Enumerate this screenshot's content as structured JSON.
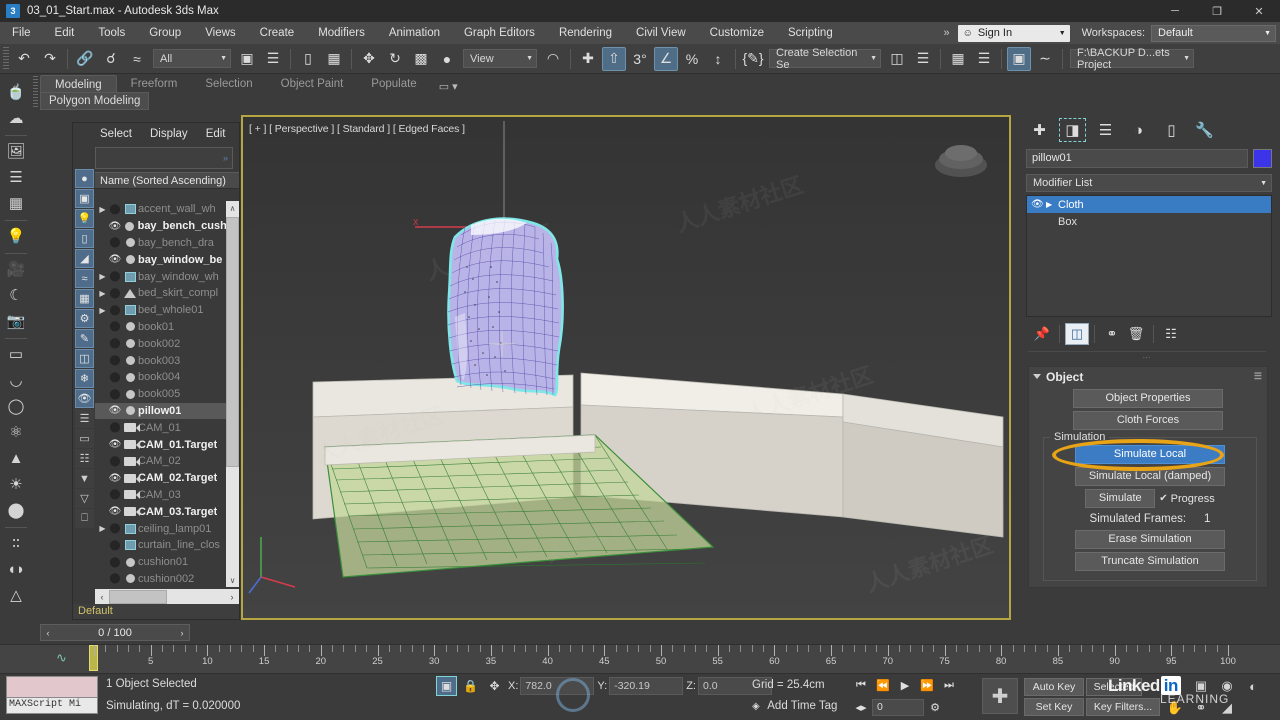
{
  "window": {
    "title": "03_01_Start.max - Autodesk 3ds Max",
    "app_badge": "3",
    "minimize": "─",
    "maximize": "❐",
    "close": "✕"
  },
  "menubar": {
    "items": [
      "File",
      "Edit",
      "Tools",
      "Group",
      "Views",
      "Create",
      "Modifiers",
      "Animation",
      "Graph Editors",
      "Rendering",
      "Civil View",
      "Customize",
      "Scripting"
    ],
    "overflow": "»",
    "sign_in": "Sign In",
    "workspaces_label": "Workspaces:",
    "workspace_value": "Default"
  },
  "toolbar": {
    "selection_filter": "All",
    "ref_coord_system": "View",
    "named_selection_sets": "Create Selection Se",
    "project_folder": "F:\\BACKUP D...ets Project",
    "icons": [
      "undo",
      "redo",
      "select-link",
      "unlink",
      "bind-space-warp",
      "select-object",
      "select-by-name",
      "rectangular-selection-region",
      "window-crossing",
      "select-and-move",
      "select-and-rotate",
      "select-and-scale",
      "placement",
      "mirror",
      "align",
      "percent-snap",
      "angle-snap",
      "spinner-snap",
      "edit-named-selection",
      "manage-layers",
      "toggle-scene-explorer",
      "curve-editor",
      "schematic-view",
      "material-editor",
      "render-setup",
      "rendered-frame-window",
      "render-production",
      "snaps-toggle"
    ]
  },
  "ribbon": {
    "tabs": [
      "Modeling",
      "Freeform",
      "Selection",
      "Object Paint",
      "Populate"
    ],
    "active_tab": "Modeling",
    "subtab": "Polygon Modeling",
    "overflow_caret": "▾"
  },
  "left_toolbar": {
    "icons": [
      "teapot-icon",
      "cloud-icon",
      "render-preview-icon",
      "list-panel-icon",
      "grid-panel-icon",
      "light-bulb-icon",
      "camera-rig-icon",
      "moon-shade-icon",
      "red-camera-icon",
      "plane-primitive-icon",
      "dome-primitive-icon",
      "sphere-primitive-icon",
      "teapot-wire-icon",
      "cone-primitive-icon",
      "sun-light-icon",
      "sphere-light-icon",
      "particles-icon",
      "dynamics-icon",
      "export-icon"
    ]
  },
  "explorer": {
    "menu": [
      "Select",
      "Display",
      "Edit"
    ],
    "search_placeholder": "",
    "search_clear": "»",
    "column_header": "Name (Sorted Ascending)",
    "side_icons": [
      "display-none-icon",
      "display-geometry-icon",
      "display-lights-icon",
      "display-cameras-icon",
      "display-helpers-icon",
      "display-space-warps-icon",
      "display-groups-icon",
      "display-xrefs-icon",
      "display-bones-icon",
      "display-containers-icon",
      "display-frozen-icon",
      "display-hidden-icon",
      "list-view-icon",
      "tile-view-icon",
      "detail-view-icon",
      "filter-funnel-icon",
      "filter-icon",
      "folder-icon"
    ],
    "items": [
      {
        "name": "accent_wall_wh",
        "expand": true,
        "visible": false,
        "type": "xref",
        "dim": true
      },
      {
        "name": "bay_bench_cush",
        "expand": false,
        "visible": true,
        "type": "geom",
        "dim": false
      },
      {
        "name": "bay_bench_dra",
        "expand": false,
        "visible": false,
        "type": "geom",
        "dim": true
      },
      {
        "name": "bay_window_be",
        "expand": false,
        "visible": true,
        "type": "geom",
        "dim": false
      },
      {
        "name": "bay_window_wh",
        "expand": true,
        "visible": false,
        "type": "xref",
        "dim": true
      },
      {
        "name": "bed_skirt_compl",
        "expand": true,
        "visible": false,
        "type": "helper",
        "dim": true
      },
      {
        "name": "bed_whole01",
        "expand": true,
        "visible": false,
        "type": "xref",
        "dim": true
      },
      {
        "name": "book01",
        "expand": false,
        "visible": false,
        "type": "geom",
        "dim": true
      },
      {
        "name": "book002",
        "expand": false,
        "visible": false,
        "type": "geom",
        "dim": true
      },
      {
        "name": "book003",
        "expand": false,
        "visible": false,
        "type": "geom",
        "dim": true
      },
      {
        "name": "book004",
        "expand": false,
        "visible": false,
        "type": "geom",
        "dim": true
      },
      {
        "name": "book005",
        "expand": false,
        "visible": false,
        "type": "geom",
        "dim": true
      },
      {
        "name": "pillow01",
        "expand": false,
        "visible": true,
        "type": "geom",
        "dim": false,
        "selected": true
      },
      {
        "name": "CAM_01",
        "expand": false,
        "visible": false,
        "type": "cam",
        "dim": true
      },
      {
        "name": "CAM_01.Target",
        "expand": false,
        "visible": true,
        "type": "cam",
        "dim": false
      },
      {
        "name": "CAM_02",
        "expand": false,
        "visible": false,
        "type": "cam",
        "dim": true
      },
      {
        "name": "CAM_02.Target",
        "expand": false,
        "visible": true,
        "type": "cam",
        "dim": false
      },
      {
        "name": "CAM_03",
        "expand": false,
        "visible": false,
        "type": "cam",
        "dim": true
      },
      {
        "name": "CAM_03.Target",
        "expand": false,
        "visible": true,
        "type": "cam",
        "dim": false
      },
      {
        "name": "ceiling_lamp01",
        "expand": true,
        "visible": false,
        "type": "xref",
        "dim": true
      },
      {
        "name": "curtain_line_clos",
        "expand": false,
        "visible": false,
        "type": "xref",
        "dim": true
      },
      {
        "name": "cushion01",
        "expand": false,
        "visible": false,
        "type": "geom",
        "dim": true
      },
      {
        "name": "cushion002",
        "expand": false,
        "visible": false,
        "type": "geom",
        "dim": true
      }
    ],
    "status": "Default",
    "scroll_up": "∧",
    "scroll_down": "∨",
    "hscroll_left": "‹",
    "hscroll_right": "›"
  },
  "viewport": {
    "label": "[ + ] [ Perspective ] [ Standard ] [ Edged Faces ]",
    "watermarks": [
      "人人素材社区",
      "人人素材社区",
      "人人素材社区",
      "人人素材社区",
      "人人素材社区",
      "人人素材社区"
    ],
    "axis_label_x": "X"
  },
  "command_panel": {
    "tabs": [
      "create-tab",
      "modify-tab",
      "hierarchy-tab",
      "motion-tab",
      "display-tab",
      "utilities-tab"
    ],
    "active_tab_index": 1,
    "object_name": "pillow01",
    "object_color": "#3b34e8",
    "modifier_list_label": "Modifier List",
    "stack": [
      {
        "label": "Cloth",
        "selected": true
      },
      {
        "label": "Box",
        "selected": false
      }
    ],
    "stack_buttons": [
      "pin-stack-icon",
      "show-end-result-icon",
      "make-unique-icon",
      "remove-modifier-icon",
      "configure-modifier-sets-icon"
    ],
    "rollout": {
      "title": "Object",
      "object_properties": "Object Properties",
      "cloth_forces": "Cloth Forces",
      "simulation_group": "Simulation",
      "simulate_local": "Simulate Local",
      "simulate_local_damped": "Simulate Local (damped)",
      "simulate": "Simulate",
      "progress_label": "Progress",
      "progress_checked": "✔",
      "simulated_frames_label": "Simulated Frames:",
      "simulated_frames_value": "1",
      "erase_simulation": "Erase Simulation",
      "truncate_simulation": "Truncate Simulation"
    },
    "highlight_color": "#e8a317"
  },
  "timeline": {
    "current_frame": "0 / 100",
    "prev_arrow": "‹",
    "next_arrow": "›",
    "ruler_labels": [
      "5",
      "10",
      "15",
      "20",
      "25",
      "30",
      "35",
      "40",
      "45",
      "50",
      "55",
      "60",
      "65",
      "70",
      "75",
      "80",
      "85",
      "90",
      "95",
      "100"
    ],
    "key_position_frame": "0"
  },
  "statusbar": {
    "maxscript_label": "MAXScript Mi",
    "line1": "1 Object Selected",
    "line2": "Simulating, dT = 0.020000",
    "coord_x_label": "X:",
    "coord_y_label": "Y:",
    "coord_z_label": "Z:",
    "coord_x_value": "782.0",
    "coord_y_value": "-320.19",
    "coord_z_value": "0.0",
    "grid": "Grid = 25.4cm",
    "add_time_tag": "Add Time Tag",
    "anim_buttons": [
      "go-to-start",
      "previous-frame",
      "play-animation",
      "next-frame",
      "go-to-end"
    ],
    "key_mode_field": "0",
    "auto_key": "Auto Key",
    "set_key": "Set Key",
    "selected_label": "Selected",
    "key_filters": "Key Filters...",
    "nav_icons": [
      "zoom-icon",
      "zoom-all-icon",
      "zoom-extents-icon",
      "field-of-view-icon",
      "pan-icon",
      "orbit-icon",
      "maximize-viewport-icon"
    ],
    "brand": "Linked",
    "brand_in": "in",
    "brand_sub": "LEARNING"
  }
}
